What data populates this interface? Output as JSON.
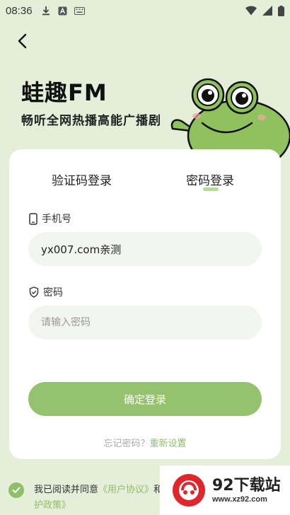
{
  "status_bar": {
    "time": "08:36"
  },
  "header": {
    "brand": "蛙趣FM",
    "slogan": "畅听全网热播高能广播剧"
  },
  "tabs": [
    {
      "label": "验证码登录",
      "active": false
    },
    {
      "label": "密码登录",
      "active": true
    }
  ],
  "phone": {
    "label": "手机号",
    "value": "yx007.com亲测"
  },
  "password": {
    "label": "密码",
    "placeholder": "请输入密码"
  },
  "login_button": {
    "label": "确定登录"
  },
  "forgot": {
    "prefix": "忘记密码？",
    "reset_label": "重新设置"
  },
  "agreement": {
    "text_before": "我已阅读并同意",
    "user_agreement": "《用户协议》",
    "text_cut": "和",
    "privacy_tail": "护政策》"
  },
  "watermark": {
    "title": "92下载站",
    "url": "www.xz92.com"
  },
  "colors": {
    "background": "#e5eed8",
    "accent": "#95c26f",
    "link": "#8fbf69"
  }
}
